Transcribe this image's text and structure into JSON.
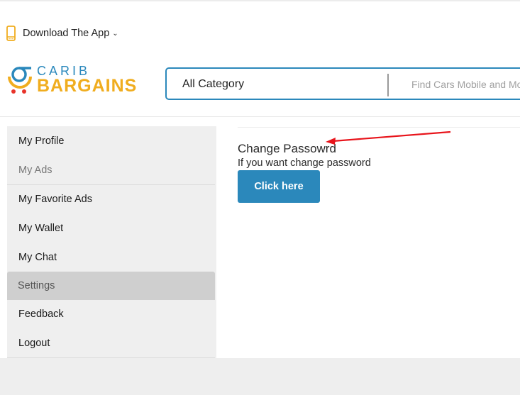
{
  "header": {
    "download_app_label": "Download The App",
    "download_app_icon": "mobile-phone-icon",
    "dropdown_icon": "chevron-down-icon",
    "logo": {
      "top_text": "CARIB",
      "bottom_text": "BARGAINS",
      "icon": "shopping-cart-logo-icon"
    },
    "search": {
      "category_label": "All Category",
      "placeholder": "Find Cars Mobile and More..."
    }
  },
  "sidebar": {
    "items": [
      {
        "label": "My Profile",
        "state": "normal"
      },
      {
        "label": "My Ads",
        "state": "muted"
      },
      {
        "label": "My Favorite Ads",
        "state": "normal"
      },
      {
        "label": "My Wallet",
        "state": "normal"
      },
      {
        "label": "My Chat",
        "state": "normal"
      },
      {
        "label": "Settings",
        "state": "active"
      },
      {
        "label": "Feedback",
        "state": "normal"
      },
      {
        "label": "Logout",
        "state": "normal"
      }
    ]
  },
  "main": {
    "change_password_title": "Change Passowrd",
    "change_password_subtitle": "If you want change password",
    "button_label": "Click here"
  },
  "annotation": {
    "icon": "red-arrow-annotation-icon"
  },
  "colors": {
    "brand_blue": "#2b88bb",
    "brand_yellow": "#f0ad1f",
    "annotation_red": "#e8141b",
    "sidebar_bg": "#efefef",
    "sidebar_active_bg": "#cfcfcf"
  }
}
